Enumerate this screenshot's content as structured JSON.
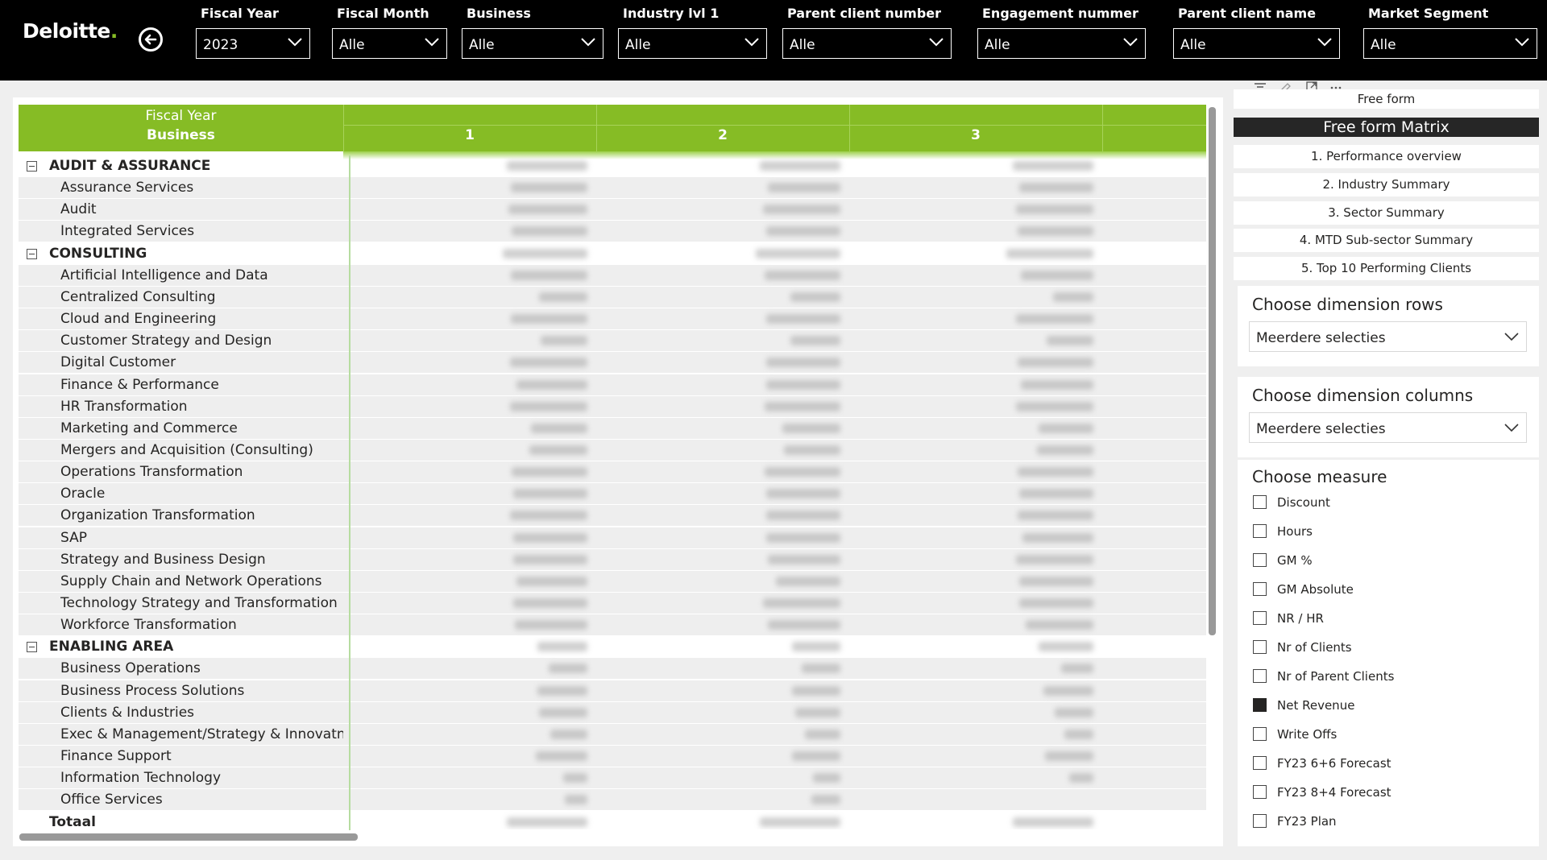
{
  "app": {
    "logo_text": "Deloitte",
    "logo_dot": "."
  },
  "filters": [
    {
      "label": "Fiscal Year",
      "value": "2023"
    },
    {
      "label": "Fiscal Month",
      "value": "Alle"
    },
    {
      "label": "Business",
      "value": "Alle"
    },
    {
      "label": "Industry lvl 1",
      "value": "Alle"
    },
    {
      "label": "Parent client number",
      "value": "Alle"
    },
    {
      "label": "Engagement nummer",
      "value": "Alle"
    },
    {
      "label": "Parent client name",
      "value": "Alle"
    },
    {
      "label": "Market Segment",
      "value": "Alle"
    }
  ],
  "matrix": {
    "header_fiscal_year": "Fiscal Year",
    "header_business": "Business",
    "columns": [
      "1",
      "2",
      "3"
    ],
    "rows": [
      {
        "label": "AUDIT & ASSURANCE",
        "type": "group"
      },
      {
        "label": "Assurance Services",
        "type": "child"
      },
      {
        "label": "Audit",
        "type": "child"
      },
      {
        "label": "Integrated Services",
        "type": "child"
      },
      {
        "label": "CONSULTING",
        "type": "group"
      },
      {
        "label": "Artificial Intelligence and Data",
        "type": "child"
      },
      {
        "label": "Centralized Consulting",
        "type": "child"
      },
      {
        "label": "Cloud and Engineering",
        "type": "child"
      },
      {
        "label": "Customer Strategy and Design",
        "type": "child"
      },
      {
        "label": "Digital Customer",
        "type": "child"
      },
      {
        "label": "Finance & Performance",
        "type": "child"
      },
      {
        "label": "HR Transformation",
        "type": "child"
      },
      {
        "label": "Marketing and Commerce",
        "type": "child"
      },
      {
        "label": "Mergers and Acquisition (Consulting)",
        "type": "child"
      },
      {
        "label": "Operations Transformation",
        "type": "child"
      },
      {
        "label": "Oracle",
        "type": "child"
      },
      {
        "label": "Organization Transformation",
        "type": "child"
      },
      {
        "label": "SAP",
        "type": "child"
      },
      {
        "label": "Strategy and Business Design",
        "type": "child"
      },
      {
        "label": "Supply Chain and Network Operations",
        "type": "child"
      },
      {
        "label": "Technology Strategy and Transformation",
        "type": "child"
      },
      {
        "label": "Workforce Transformation",
        "type": "child"
      },
      {
        "label": "ENABLING AREA",
        "type": "group"
      },
      {
        "label": "Business Operations",
        "type": "child"
      },
      {
        "label": "Business Process Solutions",
        "type": "child"
      },
      {
        "label": "Clients & Industries",
        "type": "child"
      },
      {
        "label": "Exec & Management/Strategy & Innovatn",
        "type": "child"
      },
      {
        "label": "Finance Support",
        "type": "child"
      },
      {
        "label": "Information Technology",
        "type": "child"
      },
      {
        "label": "Office Services",
        "type": "child"
      }
    ],
    "total_label": "Totaal"
  },
  "visual_title": "Free form",
  "nav": [
    {
      "label": "Free form Matrix",
      "active": true
    },
    {
      "label": "1. Performance overview"
    },
    {
      "label": "2. Industry Summary"
    },
    {
      "label": "3. Sector Summary"
    },
    {
      "label": "4. MTD Sub-sector Summary"
    },
    {
      "label": "5. Top 10 Performing Clients"
    }
  ],
  "slicers": {
    "rows": {
      "title": "Choose dimension rows",
      "value": "Meerdere selecties"
    },
    "columns": {
      "title": "Choose dimension columns",
      "value": "Meerdere selecties"
    }
  },
  "measures": {
    "title": "Choose measure",
    "items": [
      {
        "label": "Discount",
        "checked": false
      },
      {
        "label": "Hours",
        "checked": false
      },
      {
        "label": "GM %",
        "checked": false
      },
      {
        "label": "GM Absolute",
        "checked": false
      },
      {
        "label": "NR / HR",
        "checked": false
      },
      {
        "label": "Nr of Clients",
        "checked": false
      },
      {
        "label": "Nr of Parent Clients",
        "checked": false
      },
      {
        "label": "Net Revenue",
        "checked": true
      },
      {
        "label": "Write Offs",
        "checked": false
      },
      {
        "label": "FY23 6+6 Forecast",
        "checked": false
      },
      {
        "label": "FY23 8+4 Forecast",
        "checked": false
      },
      {
        "label": "FY23 Plan",
        "checked": false
      }
    ]
  },
  "colors": {
    "brand_green": "#86bc25",
    "topbar": "#000000",
    "nav_active": "#262626"
  },
  "icons": [
    "back-arrow-icon",
    "chevron-down-icon",
    "filter-icon",
    "eraser-icon",
    "focus-mode-icon",
    "more-options-icon",
    "collapse-icon"
  ]
}
